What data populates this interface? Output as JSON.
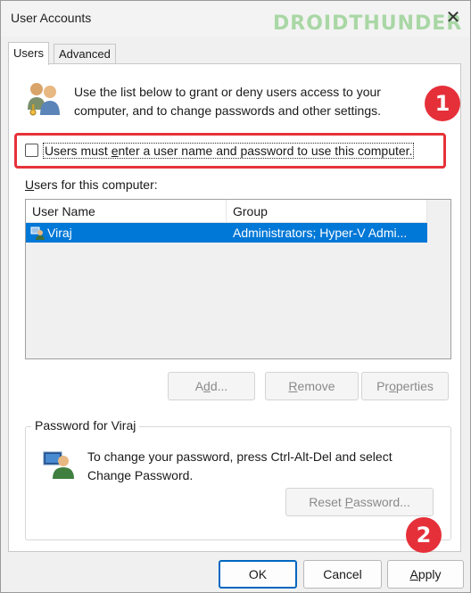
{
  "window": {
    "title": "User Accounts",
    "watermark": "DROIDTHUNDER",
    "close_glyph": "✕"
  },
  "tabs": [
    {
      "label": "Users",
      "active": true
    },
    {
      "label": "Advanced",
      "active": false
    }
  ],
  "intro": {
    "icon": "users-icon",
    "text": "Use the list below to grant or deny users access to your computer, and to change passwords and other settings."
  },
  "checkbox": {
    "label_pre": "Users must ",
    "label_accel": "e",
    "label_post": "nter a user name and password to use this computer.",
    "checked": false
  },
  "users_section": {
    "label_accel": "U",
    "label_post": "sers for this computer:",
    "columns": [
      "User Name",
      "Group"
    ],
    "rows": [
      {
        "user": "Viraj",
        "group": "Administrators; Hyper-V Admi...",
        "selected": true
      }
    ],
    "selected_color": "#0078d7"
  },
  "buttons": {
    "add_pre": "A",
    "add_accel": "d",
    "add_post": "d...",
    "remove_accel": "R",
    "remove_post": "emove",
    "properties_pre": "Pr",
    "properties_accel": "o",
    "properties_post": "perties"
  },
  "password": {
    "group_title": "Password for Viraj",
    "icon": "user-key-icon",
    "text": "To change your password, press Ctrl-Alt-Del and select Change Password.",
    "reset_pre": "Reset ",
    "reset_accel": "P",
    "reset_post": "assword..."
  },
  "dialog_buttons": {
    "ok": "OK",
    "cancel": "Cancel",
    "apply_accel": "A",
    "apply_post": "pply"
  },
  "annotations": {
    "badge1": "1",
    "badge2": "2",
    "color": "#e5303a"
  }
}
